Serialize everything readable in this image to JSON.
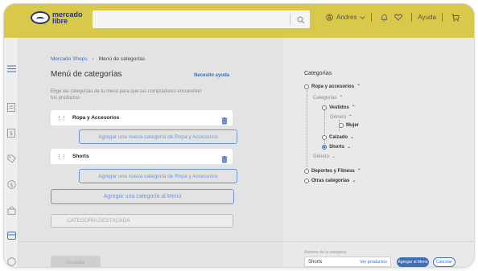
{
  "header": {
    "logo_text_line1": "mercado",
    "logo_text_line2": "libre",
    "search_placeholder": "",
    "user_name": "Andres",
    "help_label": "Ayuda"
  },
  "breadcrumb": {
    "root": "Mercado Shops",
    "current": "Menú de categorías"
  },
  "page": {
    "title": "Menú de categorías",
    "help_link": "Necesito ayuda",
    "description": "Elige las categorías de tu menú para que tus compradores encuentren tus productos"
  },
  "categories": [
    {
      "name": "Ropa y Accesorios",
      "add_label": "Agregar una nueva categoría de Ropa y Accesorios"
    },
    {
      "name": "Shorts",
      "add_label": "Agregar una nueva categoría de Ropa y Accesorios"
    }
  ],
  "add_category_label": "Agregar una categoría al Menú",
  "featured_label": "CATEGORÍA DESTACADA",
  "save_label": "Guardar",
  "preview": {
    "title": "Categorías",
    "tree": {
      "ropa": "Ropa y accesorios",
      "categorias": "Categorías",
      "vestidos": "Vestidos",
      "genero1": "Género",
      "mujer": "Mujer",
      "calzado": "Calzado",
      "shorts": "Shorts",
      "genero2": "Género",
      "deportes": "Deportes y Fitness",
      "otras": "Otras categorías"
    },
    "field_label": "Nombre de la categoría",
    "field_value": "Shorts",
    "view_products": "Ver productos",
    "add_button": "Agregar al Menú",
    "cancel_button": "Cancelar"
  },
  "colors": {
    "header": "#d8c94a",
    "accent": "#3b6fb6",
    "logo": "#2d3277"
  }
}
